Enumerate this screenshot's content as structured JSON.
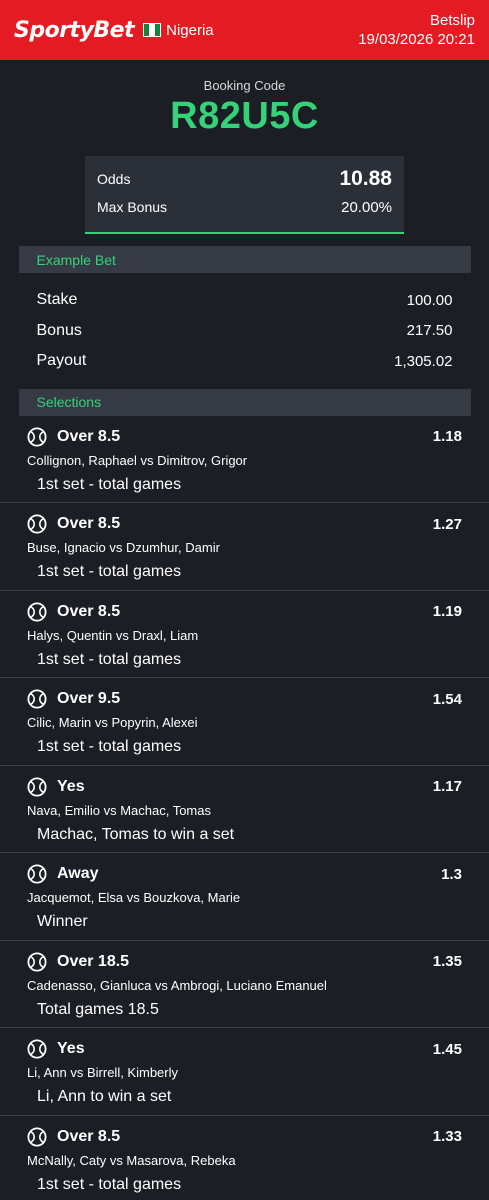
{
  "header": {
    "logo": "SportyBet",
    "country": "Nigeria",
    "title": "Betslip",
    "datetime": "19/03/2026 20:21",
    "brand_color": "#e41b23"
  },
  "booking": {
    "label": "Booking Code",
    "code": "R82U5C",
    "accent_color": "#35d27a"
  },
  "summary": {
    "odds_label": "Odds",
    "odds_value": "10.88",
    "bonus_label": "Max Bonus",
    "bonus_value": "20.00%"
  },
  "example": {
    "title": "Example Bet",
    "rows": [
      {
        "label": "Stake",
        "value": "100.00"
      },
      {
        "label": "Bonus",
        "value": "217.50"
      },
      {
        "label": "Payout",
        "value": "1,305.02"
      }
    ]
  },
  "selections": {
    "title": "Selections",
    "icon": "tennis-ball-icon",
    "items": [
      {
        "pick": "Over 8.5",
        "odd": "1.18",
        "match": "Collignon, Raphael vs Dimitrov, Grigor",
        "market": "1st set - total games"
      },
      {
        "pick": "Over 8.5",
        "odd": "1.27",
        "match": "Buse, Ignacio vs Dzumhur, Damir",
        "market": "1st set - total games"
      },
      {
        "pick": "Over 8.5",
        "odd": "1.19",
        "match": "Halys, Quentin vs Draxl, Liam",
        "market": "1st set - total games"
      },
      {
        "pick": "Over 9.5",
        "odd": "1.54",
        "match": "Cilic, Marin vs Popyrin, Alexei",
        "market": "1st set - total games"
      },
      {
        "pick": "Yes",
        "odd": "1.17",
        "match": "Nava, Emilio vs Machac, Tomas",
        "market": "Machac, Tomas to win a set"
      },
      {
        "pick": "Away",
        "odd": "1.3",
        "match": "Jacquemot, Elsa vs Bouzkova, Marie",
        "market": "Winner"
      },
      {
        "pick": "Over 18.5",
        "odd": "1.35",
        "match": "Cadenasso, Gianluca vs Ambrogi, Luciano Emanuel",
        "market": "Total games 18.5"
      },
      {
        "pick": "Yes",
        "odd": "1.45",
        "match": "Li, Ann vs Birrell, Kimberly",
        "market": "Li, Ann to win a set"
      },
      {
        "pick": "Over 8.5",
        "odd": "1.33",
        "match": "McNally, Caty vs Masarova, Rebeka",
        "market": "1st set - total games"
      }
    ]
  }
}
